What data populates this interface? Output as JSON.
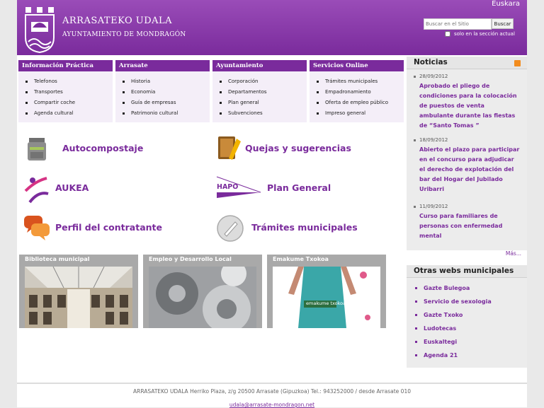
{
  "header": {
    "title": "ARRASATEKO UDALA",
    "subtitle": "AYUNTAMIENTO DE MONDRAGÓN",
    "language_link": "Euskara",
    "search_placeholder": "Buscar en el Sitio",
    "search_button": "Buscar",
    "section_only_label": "solo en la sección actual"
  },
  "nav": [
    {
      "title": "Información Práctica",
      "items": [
        "Telefonos",
        "Transportes",
        "Compartir coche",
        "Agenda cultural"
      ]
    },
    {
      "title": "Arrasate",
      "items": [
        "Historia",
        "Economia",
        "Guía de empresas",
        "Patrimonio cultural"
      ]
    },
    {
      "title": "Ayuntamiento",
      "items": [
        "Corporación",
        "Departamentos",
        "Plan general",
        "Subvenciones"
      ]
    },
    {
      "title": "Servicios Online",
      "items": [
        "Trámites municipales",
        "Empadronamiento",
        "Oferta de empleo público",
        "Impreso general"
      ]
    }
  ],
  "features": [
    {
      "label": "Autocompostaje",
      "icon": "compost-bin-icon"
    },
    {
      "label": "Quejas y sugerencias",
      "icon": "notebook-pen-icon"
    },
    {
      "label": "AUKEA",
      "icon": "aukea-logo-icon"
    },
    {
      "label": "Plan General",
      "icon": "hapo-logo-icon",
      "logo_text": "HAPO"
    },
    {
      "label": "Perfil del contratante",
      "icon": "speech-bubbles-icon"
    },
    {
      "label": "Trámites municipales",
      "icon": "pencil-circle-icon"
    }
  ],
  "tiles": [
    {
      "title": "Biblioteca municipal"
    },
    {
      "title": "Empleo y Desarrollo Local"
    },
    {
      "title": "Emakume Txokoa",
      "image_text": "emakume txokoa"
    }
  ],
  "news": {
    "title": "Noticias",
    "items": [
      {
        "date": "28/09/2012",
        "text": "Aprobado el pliego de condiciones para la colocación de puestos de venta ambulante durante las fiestas de “Santo Tomas ”"
      },
      {
        "date": "18/09/2012",
        "text": "Abierto el plazo para participar en el concurso para adjudicar el derecho de explotación del bar del Hogar del Jubilado Uribarri"
      },
      {
        "date": "11/09/2012",
        "text": "Curso para familiares de personas con enfermedad mental"
      }
    ],
    "more": "Más..."
  },
  "other_sites": {
    "title": "Otras webs municipales",
    "items": [
      "Gazte Bulegoa",
      "Servicio de sexologia",
      "Gazte Txoko",
      "Ludotecas",
      "Euskaltegi",
      "Agenda 21"
    ]
  },
  "footer": {
    "address": "ARRASATEKO UDALA    Herriko Plaza, z/g 20500 Arrasate (Gipuzkoa)    Tel.: 943252000 / desde Arrasate 010",
    "email": "udala@arrasate-mondragon.net"
  },
  "colors": {
    "brand": "#7a2b9c",
    "link": "#7a2b9c"
  }
}
